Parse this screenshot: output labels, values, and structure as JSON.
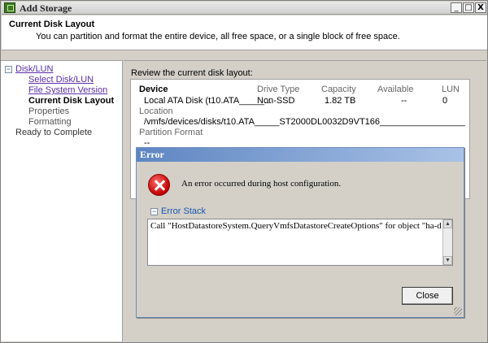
{
  "window": {
    "title": "Add Storage",
    "controls": {
      "minimize": "_",
      "maximize": "□",
      "close": "X"
    }
  },
  "header": {
    "title": "Current Disk Layout",
    "subtitle": "You can partition and format the entire device, all free space, or a single block of free space."
  },
  "nav": {
    "group": "Disk/LUN",
    "items": [
      "Select Disk/LUN",
      "File System Version",
      "Current Disk Layout",
      "Properties",
      "Formatting",
      "Ready to Complete"
    ],
    "expander": "−"
  },
  "review": {
    "label": "Review the current disk layout:",
    "columns": {
      "device": "Device",
      "drive_type": "Drive Type",
      "capacity": "Capacity",
      "available": "Available",
      "lun": "LUN"
    },
    "row": {
      "device": "Local ATA Disk (t10.ATA_____...",
      "drive_type": "Non-SSD",
      "capacity": "1.82 TB",
      "available": "--",
      "lun": "0"
    },
    "location_label": "Location",
    "location_value": "/vmfs/devices/disks/t10.ATA_____ST2000DL0032D9VT166____________________...",
    "partition_label": "Partition Format",
    "partition_value": "--"
  },
  "dialog": {
    "title": "Error",
    "message": "An error occurred during host configuration.",
    "stack_label": "Error Stack",
    "stack_toggle": "−",
    "stack_text": "Call \"HostDatastoreSystem.QueryVmfsDatastoreCreateOptions\" for object \"ha-datastoresystem\" on ESXi",
    "scroll_up": "▲",
    "scroll_down": "▼",
    "close_label": "Close"
  }
}
